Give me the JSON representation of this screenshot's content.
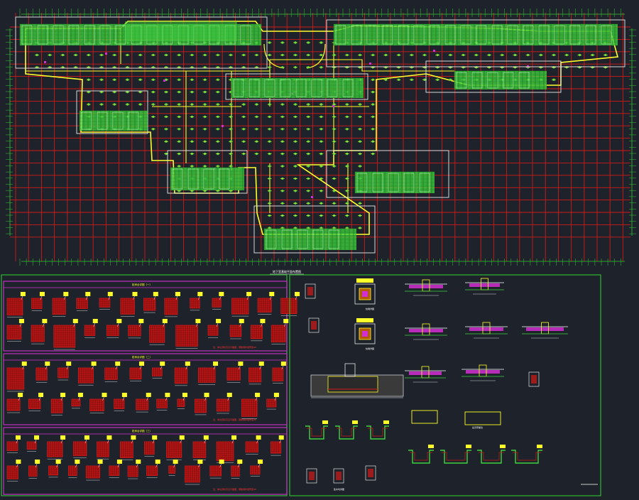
{
  "drawing": {
    "plan_title": "地下室基础平面布置图",
    "scale_label": "",
    "panel_titles": [
      "桩承台详图（一）",
      "桩承台详图（二）",
      "桩承台详图（三）"
    ],
    "panel_notes": [
      "注：承台顶标高见平面图，钢筋保护层厚度40",
      "注：承台顶标高见平面图，钢筋保护层厚度40",
      "注：承台顶标高见平面图，钢筋保护层厚度40"
    ],
    "detail_captions": [
      "柱墩详图",
      "柱墩详图",
      "后浇带做法",
      "集水坑详图"
    ]
  },
  "colors": {
    "background": "#1e232b",
    "grid_red": "#d11a1a",
    "axis_green": "#34c734",
    "building_green": "#3fd23f",
    "wall_yellow": "#ffff2a",
    "frame_white": "#e8e8e8",
    "accent_magenta": "#d22fd2",
    "panel_green": "#2fb82f"
  }
}
